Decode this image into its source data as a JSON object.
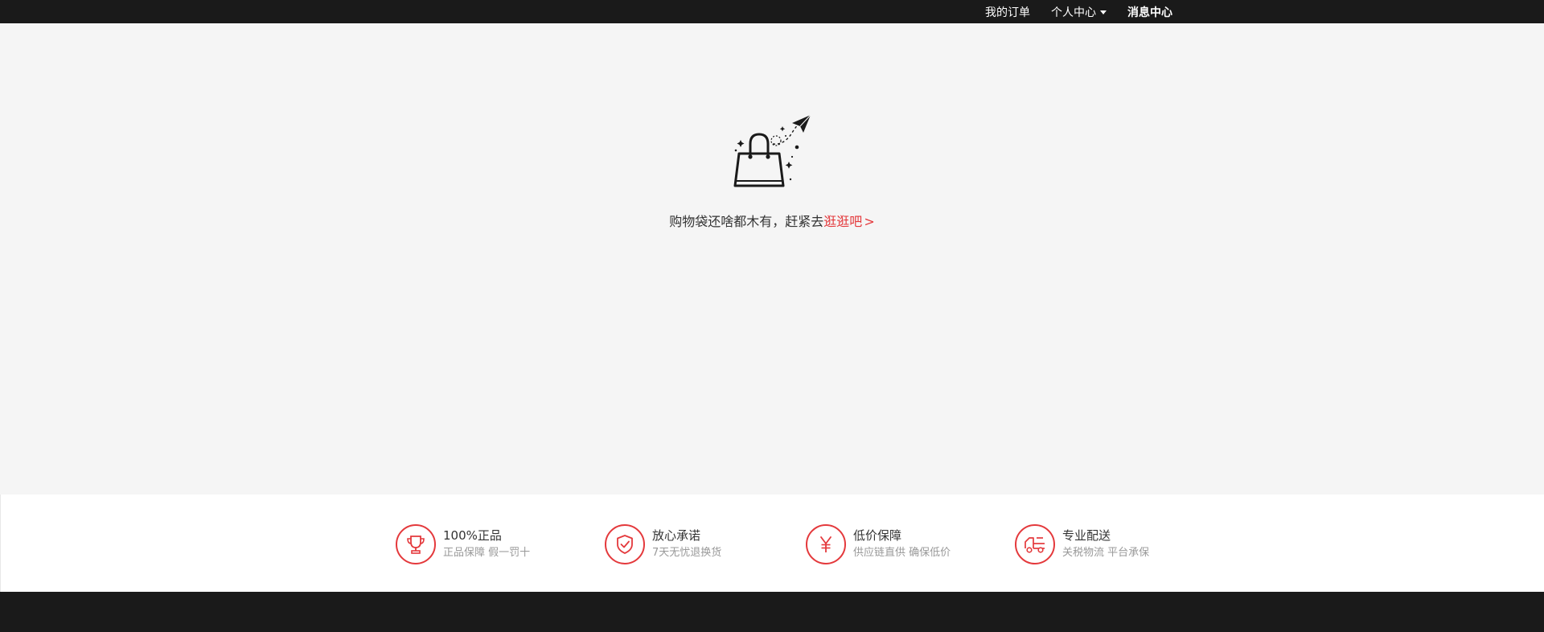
{
  "topbar": {
    "my_orders": "我的订单",
    "personal_center": "个人中心",
    "message_center": "消息中心"
  },
  "empty_cart": {
    "message": "购物袋还啥都木有，赶紧去",
    "link": "逛逛吧",
    "arrow": ">"
  },
  "guarantees": [
    {
      "title": "100%正品",
      "subtitle": "正品保障  假一罚十",
      "icon": "trophy-icon"
    },
    {
      "title": "放心承诺",
      "subtitle": "7天无忧退换货",
      "icon": "shield-check-icon"
    },
    {
      "title": "低价保障",
      "subtitle": "供应链直供  确保低价",
      "icon": "yen-icon"
    },
    {
      "title": "专业配送",
      "subtitle": "关税物流 平台承保",
      "icon": "truck-icon"
    }
  ],
  "colors": {
    "accent": "#e4393c",
    "topbar_bg": "#1a1a1a",
    "page_bg": "#f5f5f5"
  }
}
